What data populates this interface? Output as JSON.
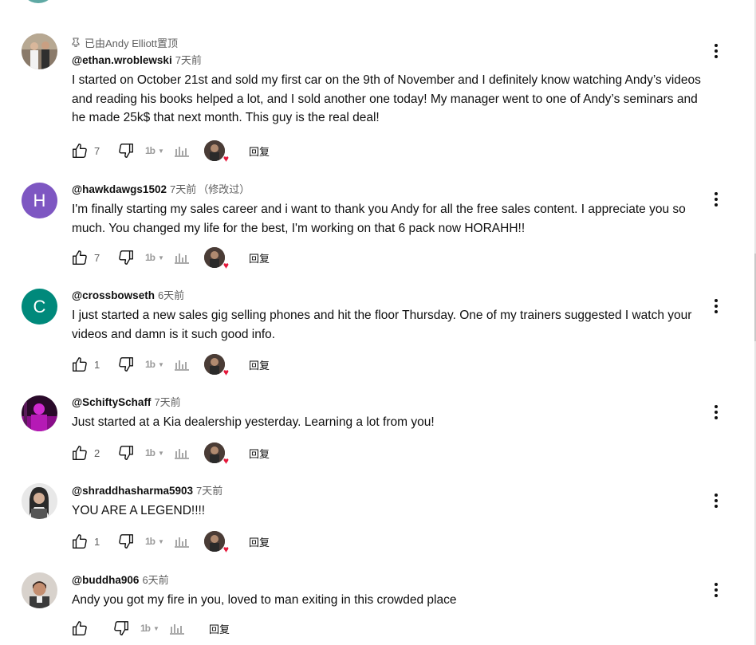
{
  "colors": {
    "accent_heart": "#e5173a",
    "muted_text": "#606060",
    "text": "#0f0f0f"
  },
  "icons": {
    "pin": "pin-icon",
    "like": "thumbs-up-icon",
    "dislike": "thumbs-down-icon",
    "translate": "translate-icon",
    "stats": "bar-chart-icon",
    "menu": "more-vertical-icon",
    "heart": "heart-icon"
  },
  "comments": [
    {
      "pinned_text": "已由Andy Elliott置顶",
      "author": "@ethan.wroblewski",
      "time": "7天前",
      "edited": "",
      "text": "I started on October 21st and sold my first car on the 9th of November and I definitely know watching Andy’s videos and reading his books helped a lot, and I sold another one today! My manager went to one of Andy’s seminars and he made 25k$ that next month. This guy is the real deal!",
      "likes": "7",
      "reply": "回复"
    },
    {
      "author": "@hawkdawgs1502",
      "avatar_letter": "H",
      "avatar_color": "#7e57c2",
      "time": "7天前",
      "edited": "（修改过）",
      "text": "I'm finally starting my sales career and i want to thank you Andy for all the free sales content. I appreciate you so much. You changed my life for the best, I'm working on that 6 pack now HORAHH!!",
      "likes": "7",
      "reply": "回复"
    },
    {
      "author": "@crossbowseth",
      "avatar_letter": "C",
      "avatar_color": "#00897b",
      "time": "6天前",
      "edited": "",
      "text": "I just started a new sales gig selling phones and hit the floor Thursday. One of my trainers suggested I watch your videos and damn is it such good info.",
      "likes": "1",
      "reply": "回复"
    },
    {
      "author": "@SchiftySchaff",
      "time": "7天前",
      "edited": "",
      "text": "Just started at a Kia dealership yesterday. Learning a lot from you!",
      "likes": "2",
      "reply": "回复"
    },
    {
      "author": "@shraddhasharma5903",
      "time": "7天前",
      "edited": "",
      "text": "YOU ARE A LEGEND!!!!",
      "likes": "1",
      "reply": "回复"
    },
    {
      "author": "@buddha906",
      "time": "6天前",
      "edited": "",
      "text": "Andy you got my fire in you, loved to man exiting in this crowded place",
      "likes": "",
      "reply": "回复"
    }
  ]
}
